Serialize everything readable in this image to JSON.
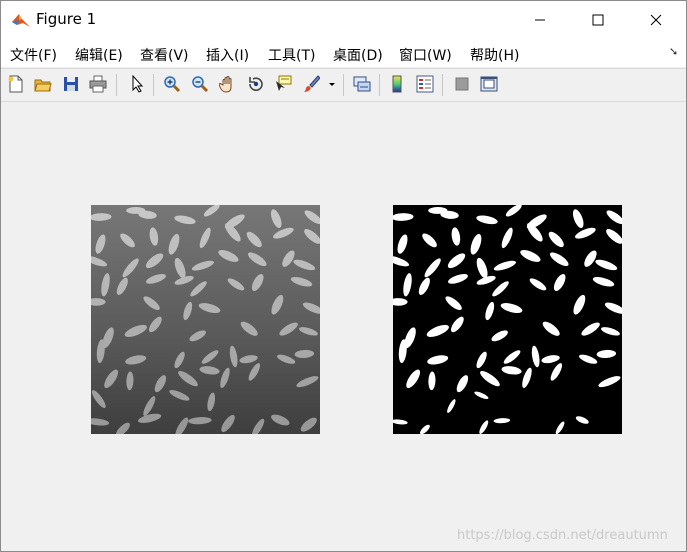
{
  "window": {
    "title": "Figure 1"
  },
  "menubar": {
    "items": [
      "文件(F)",
      "编辑(E)",
      "查看(V)",
      "插入(I)",
      "工具(T)",
      "桌面(D)",
      "窗口(W)",
      "帮助(H)"
    ]
  },
  "toolbar": {
    "icons": [
      "new-figure-icon",
      "open-file-icon",
      "save-icon",
      "print-icon",
      "edit-plot-icon",
      "zoom-in-icon",
      "zoom-out-icon",
      "pan-icon",
      "rotate-3d-icon",
      "data-cursor-icon",
      "brush-icon",
      "brush-menu-icon",
      "link-plot-icon",
      "insert-colorbar-icon",
      "insert-legend-icon",
      "hide-plot-tools-icon",
      "show-plot-tools-icon"
    ]
  },
  "axes": [
    {
      "name": "rice-grayscale-image",
      "kind": "grayscale",
      "background": "#5c5c5c",
      "grain_color": "#b4b4b4"
    },
    {
      "name": "rice-binary-image",
      "kind": "binary",
      "background": "#000000",
      "grain_color": "#ffffff"
    }
  ],
  "watermark": "https://blog.csdn.net/dreautumn"
}
